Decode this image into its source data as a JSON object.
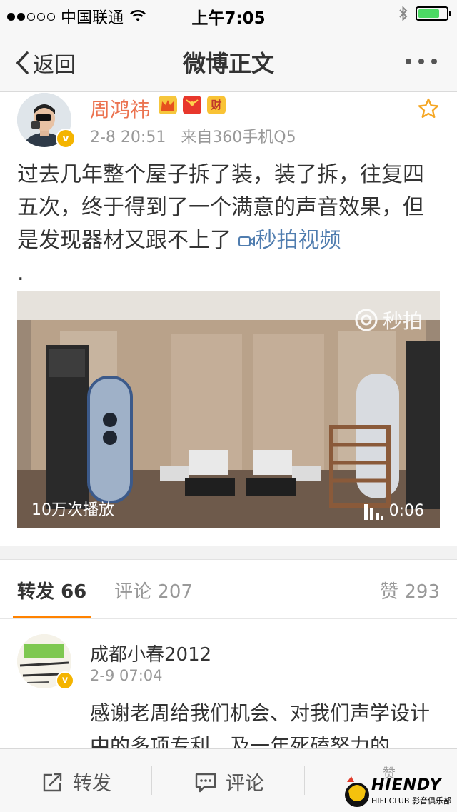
{
  "status_bar": {
    "carrier": "中国联通",
    "time": "上午7:05",
    "signal_bars_filled": 2,
    "signal_bars_total": 5,
    "battery_level": 0.75
  },
  "nav": {
    "back_label": "返回",
    "title": "微博正文"
  },
  "post": {
    "author": "周鸿祎",
    "time": "2-8 20:51",
    "source": "来自360手机Q5",
    "text": "过去几年整个屋子拆了装，装了拆，往复四五次，终于得到了一个满意的声音效果，但是发现器材又跟不上了",
    "link_label": "秒拍视频",
    "trailing": ".",
    "badge_cai": "财",
    "video": {
      "logo_text": "秒拍",
      "play_count": "10万次播放",
      "duration": "0:06"
    }
  },
  "tabs": {
    "repost_label": "转发",
    "repost_count": "66",
    "comment_label": "评论",
    "comment_count": "207",
    "like_label": "赞",
    "like_count": "293"
  },
  "comment": {
    "name": "成都小春2012",
    "time": "2-9 07:04",
    "text": "感谢老周给我们机会、对我们声学设计中的多项专利、及一年死磕努力的"
  },
  "bottom_bar": {
    "repost": "转发",
    "comment": "评论",
    "like": "赞"
  },
  "watermark": {
    "brand": "HIENDY",
    "sub": "HIFI CLUB 影音俱乐部"
  },
  "colors": {
    "accent_orange": "#ff8200",
    "author_name": "#eb7350",
    "link_blue": "#507daf",
    "verified_badge": "#f4b400"
  }
}
